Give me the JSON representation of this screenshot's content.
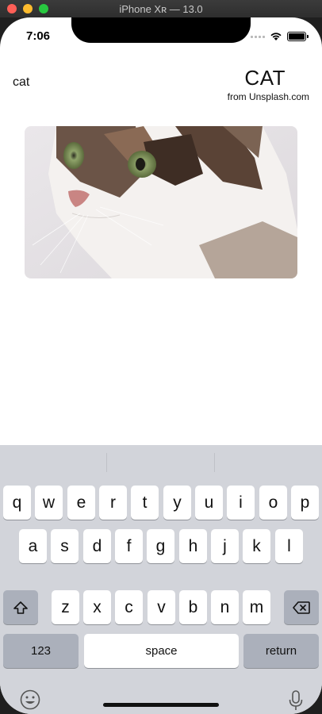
{
  "window": {
    "title": "iPhone Xʀ — 13.0"
  },
  "status_bar": {
    "time": "7:06"
  },
  "nav": {
    "left": "cat",
    "title": "CAT",
    "subtitle": "from Unsplash.com"
  },
  "keyboard": {
    "row1": [
      "q",
      "w",
      "e",
      "r",
      "t",
      "y",
      "u",
      "i",
      "o",
      "p"
    ],
    "row2": [
      "a",
      "s",
      "d",
      "f",
      "g",
      "h",
      "j",
      "k",
      "l"
    ],
    "row3": [
      "z",
      "x",
      "c",
      "v",
      "b",
      "n",
      "m"
    ],
    "numbers": "123",
    "space": "space",
    "return": "return"
  },
  "colors": {
    "keyboard_bg": "#d2d4da",
    "key_light": "#ffffff",
    "key_dark": "#abb0bb"
  }
}
